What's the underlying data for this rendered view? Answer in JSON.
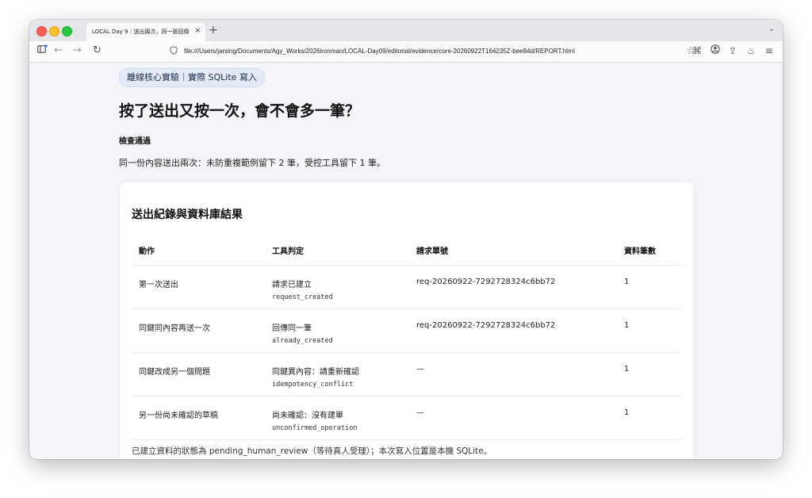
{
  "browser": {
    "tab_title": "LOCAL Day 9｜送出兩次，同一張回條",
    "tab_close": "×",
    "new_tab": "+",
    "tab_menu": "⌄",
    "url": "file:///Users/jarsing/Documents/Agy_Works/2026ironman/LOCAL-Day09/editorial/evidence/core-20260922T164235Z-bee84d/REPORT.html"
  },
  "page": {
    "pill": "離線核心實驗｜實際 SQLite 寫入",
    "title": "按了送出又按一次，會不會多一筆？",
    "status": "檢查通過",
    "summary": "同一份內容送出兩次：未防重複範例留下 2 筆，受控工具留下 1 筆。"
  },
  "card": {
    "title": "送出紀錄與資料庫結果",
    "headers": [
      "動作",
      "工具判定",
      "請求單號",
      "資料筆數"
    ],
    "rows": [
      {
        "action": "第一次送出",
        "verdict": "請求已建立",
        "code": "request_created",
        "request_id": "req-20260922-7292728324c6bb72",
        "count": "1"
      },
      {
        "action": "同鍵同內容再送一次",
        "verdict": "回傳同一筆",
        "code": "already_created",
        "request_id": "req-20260922-7292728324c6bb72",
        "count": "1"
      },
      {
        "action": "同鍵改成另一個問題",
        "verdict": "同鍵異內容：請重新確認",
        "code": "idempotency_conflict",
        "request_id": "—",
        "count": "1"
      },
      {
        "action": "另一份尚未確認的草稿",
        "verdict": "尚未確認：沒有建單",
        "code": "unconfirmed_operation",
        "request_id": "—",
        "count": "1"
      }
    ],
    "footer": "已建立資料的狀態為 pending_human_review（等待真人受理）；本次寫入位置是本機 SQLite。"
  }
}
